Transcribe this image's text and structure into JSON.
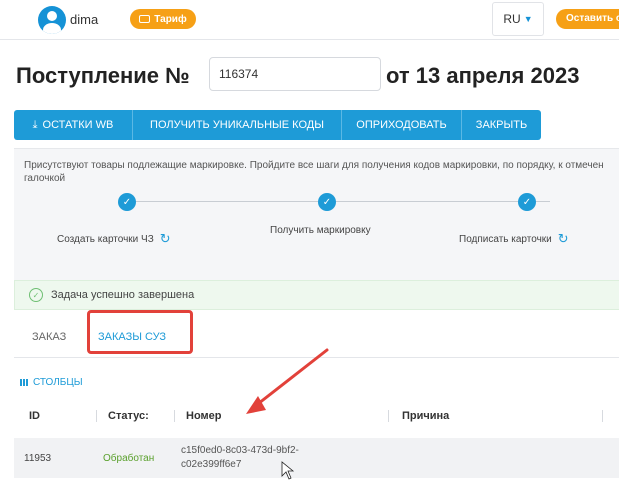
{
  "header": {
    "user_name": "dima",
    "tariff_label": "Тариф",
    "language": "RU",
    "feedback_label": "Оставить отзыв"
  },
  "document": {
    "title_prefix": "Поступление №",
    "number_value": "116374",
    "title_suffix": "от 13 апреля 2023"
  },
  "actions": {
    "stock_wb": "ОСТАТКИ WB",
    "get_codes": "ПОЛУЧИТЬ УНИКАЛЬНЫЕ КОДЫ",
    "post": "ОПРИХОДОВАТЬ",
    "close": "ЗАКРЫТЬ"
  },
  "steps": {
    "notice": "Присутствуют товары подлежащие маркировке. Пройдите все шаги для получения кодов маркировки, по порядку, к отмечен галочкой",
    "items": [
      {
        "label": "Создать карточки ЧЗ"
      },
      {
        "label": "Получить маркировку"
      },
      {
        "label": "Подписать карточки"
      }
    ]
  },
  "status": {
    "message": "Задача успешно завершена"
  },
  "tabs": [
    {
      "label": "ЗАКАЗ"
    },
    {
      "label": "ЗАКАЗЫ СУЗ"
    }
  ],
  "table": {
    "columns_label": "СТОЛБЦЫ",
    "headers": [
      "ID",
      "Статус:",
      "Номер",
      "Причина"
    ],
    "rows": [
      {
        "id": "11953",
        "status": "Обработан",
        "number": "c15f0ed0-8c03-473d-9bf2-c02e399ff6e7",
        "reason": ""
      }
    ]
  },
  "colors": {
    "accent": "#1e9bd7",
    "tariff": "#f6a016",
    "highlight": "#e2413a",
    "status_ok": "#5aa02c"
  }
}
